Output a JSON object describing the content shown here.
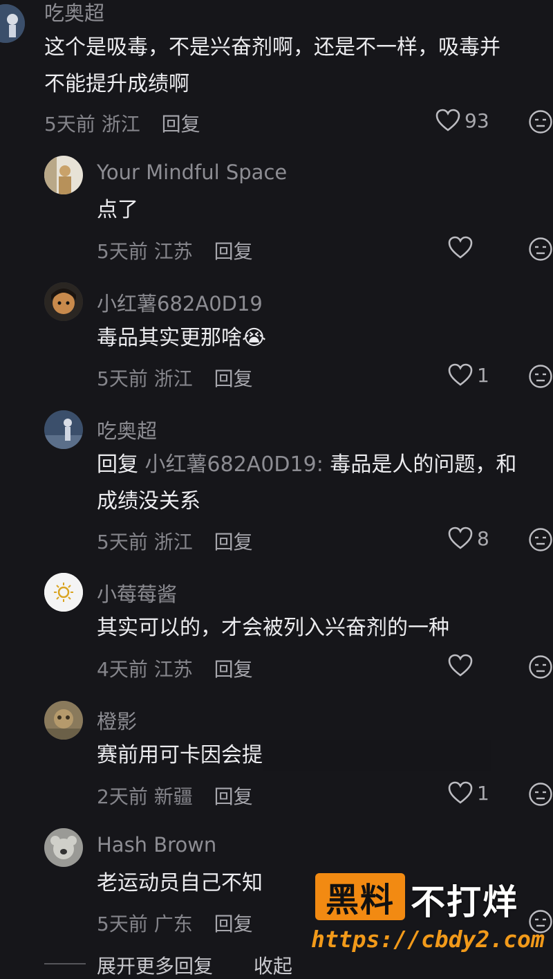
{
  "comments": [
    {
      "name": "吃奥超",
      "lines": [
        "这个是吸毒，不是兴奋剂啊，还是不一样，吸毒并",
        "不能提升成绩啊"
      ],
      "time": "5天前",
      "location": "浙江",
      "reply": "回复",
      "likes": "93"
    },
    {
      "name": "Your Mindful Space",
      "lines": [
        "点了"
      ],
      "time": "5天前",
      "location": "江苏",
      "reply": "回复",
      "likes": ""
    },
    {
      "name": "小红薯682A0D19",
      "lines": [
        "毒品其实更那啥😭"
      ],
      "time": "5天前",
      "location": "浙江",
      "reply": "回复",
      "likes": "1"
    },
    {
      "name": "吃奥超",
      "reply_prefix": "回复",
      "mention": "小红薯682A0D19:",
      "lines": [
        " 毒品是人的问题，和",
        "成绩没关系"
      ],
      "time": "5天前",
      "location": "浙江",
      "reply": "回复",
      "likes": "8"
    },
    {
      "name": "小莓莓酱",
      "lines": [
        "其实可以的，才会被列入兴奋剂的一种"
      ],
      "time": "4天前",
      "location": "江苏",
      "reply": "回复",
      "likes": ""
    },
    {
      "name": "橙影",
      "lines": [
        "赛前用可卡因会提"
      ],
      "time": "2天前",
      "location": "新疆",
      "reply": "回复",
      "likes": "1"
    },
    {
      "name": "Hash Brown",
      "lines": [
        "老运动员自己不知"
      ],
      "time": "5天前",
      "location": "广东",
      "reply": "回复",
      "likes": ""
    }
  ],
  "footer": {
    "expand": "展开更多回复",
    "collapse": "收起"
  },
  "watermark": {
    "box": "黑料",
    "text": "不打烊",
    "url": "https://cbdy2.com"
  },
  "colors": {
    "background": "#16161a",
    "watermark_orange": "#f28a12"
  }
}
